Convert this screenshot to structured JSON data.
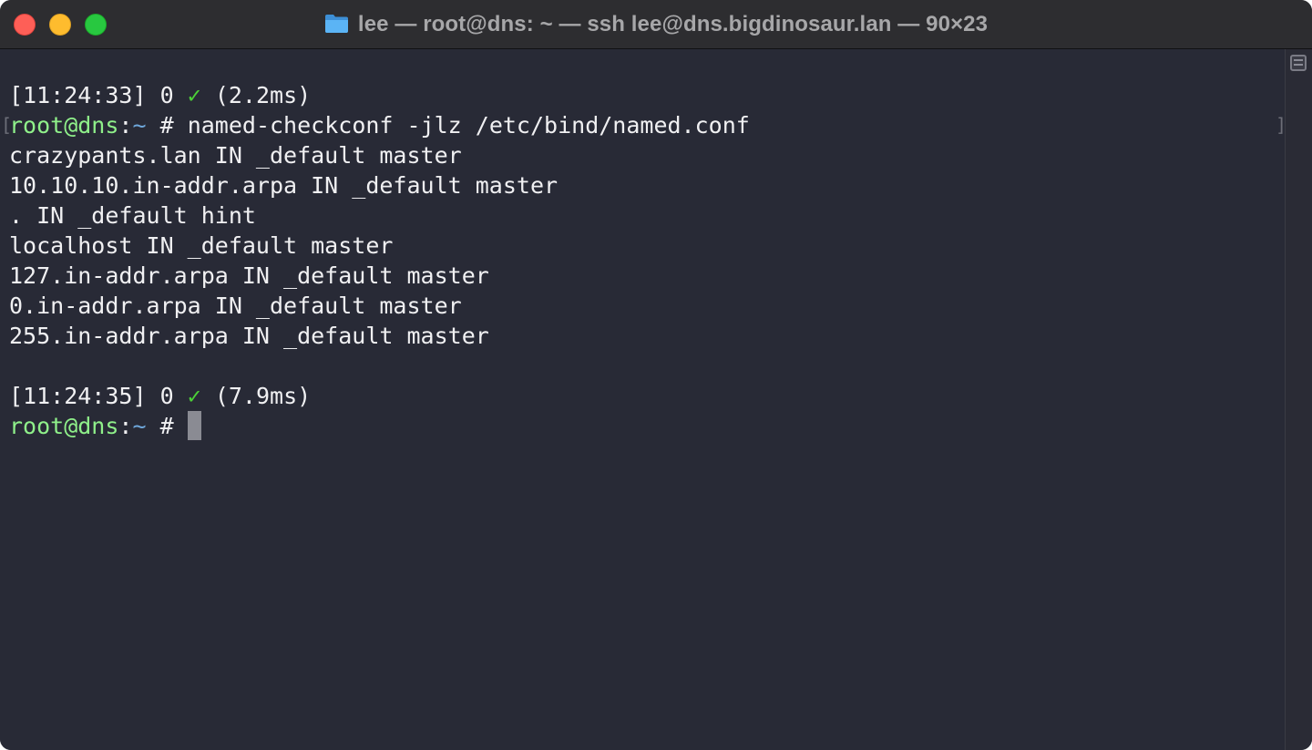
{
  "window": {
    "title": "lee — root@dns: ~ — ssh lee@dns.bigdinosaur.lan — 90×23"
  },
  "colors": {
    "background": "#282a36",
    "prompt_user": "#8ff08a",
    "prompt_path": "#6fa8dc",
    "check": "#4cd137",
    "text": "#f0f0f2"
  },
  "terminal": {
    "status1": {
      "time": "[11:24:33]",
      "code": "0",
      "check": "✓",
      "duration": "(2.2ms)"
    },
    "prompt1": {
      "user_host": "root@dns",
      "colon": ":",
      "path": "~",
      "hash": " # ",
      "command": "named-checkconf -jlz /etc/bind/named.conf"
    },
    "output": [
      "crazypants.lan IN _default master",
      "10.10.10.in-addr.arpa IN _default master",
      ". IN _default hint",
      "localhost IN _default master",
      "127.in-addr.arpa IN _default master",
      "0.in-addr.arpa IN _default master",
      "255.in-addr.arpa IN _default master"
    ],
    "status2": {
      "time": "[11:24:35]",
      "code": "0",
      "check": "✓",
      "duration": "(7.9ms)"
    },
    "prompt2": {
      "user_host": "root@dns",
      "colon": ":",
      "path": "~",
      "hash": " # "
    },
    "bracket_left": "[",
    "bracket_right": "]"
  }
}
